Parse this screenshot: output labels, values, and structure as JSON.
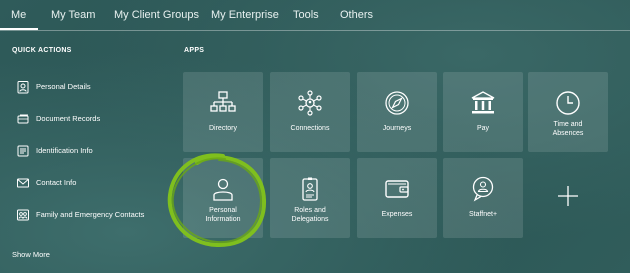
{
  "nav": {
    "tabs": [
      {
        "label": "Me"
      },
      {
        "label": "My Team"
      },
      {
        "label": "My Client Groups"
      },
      {
        "label": "My Enterprise"
      },
      {
        "label": "Tools"
      },
      {
        "label": "Others"
      }
    ],
    "active_tab": "Me"
  },
  "quick_actions": {
    "heading": "QUICK ACTIONS",
    "items": [
      {
        "label": "Personal Details",
        "icon": "person-badge-icon"
      },
      {
        "label": "Document Records",
        "icon": "documents-icon"
      },
      {
        "label": "Identification Info",
        "icon": "id-card-icon"
      },
      {
        "label": "Contact Info",
        "icon": "envelope-icon"
      },
      {
        "label": "Family and Emergency Contacts",
        "icon": "family-icon"
      }
    ],
    "show_more": "Show More"
  },
  "apps": {
    "heading": "APPS",
    "tiles": [
      {
        "line1": "Directory",
        "line2": "",
        "icon": "org-chart-icon"
      },
      {
        "line1": "Connections",
        "line2": "",
        "icon": "network-icon"
      },
      {
        "line1": "Journeys",
        "line2": "",
        "icon": "compass-icon"
      },
      {
        "line1": "Pay",
        "line2": "",
        "icon": "bank-icon"
      },
      {
        "line1": "Time and",
        "line2": "Absences",
        "icon": "clock-icon"
      },
      {
        "line1": "Personal",
        "line2": "Information",
        "icon": "person-icon"
      },
      {
        "line1": "Roles and",
        "line2": "Delegations",
        "icon": "badge-icon"
      },
      {
        "line1": "Expenses",
        "line2": "",
        "icon": "wallet-icon"
      },
      {
        "line1": "Staffnet+",
        "line2": "",
        "icon": "chat-person-icon"
      }
    ]
  },
  "colors": {
    "background": "#2f5b5a",
    "tile": "rgba(255,255,255,0.12)",
    "highlight_circle": "#7fbf1e"
  }
}
